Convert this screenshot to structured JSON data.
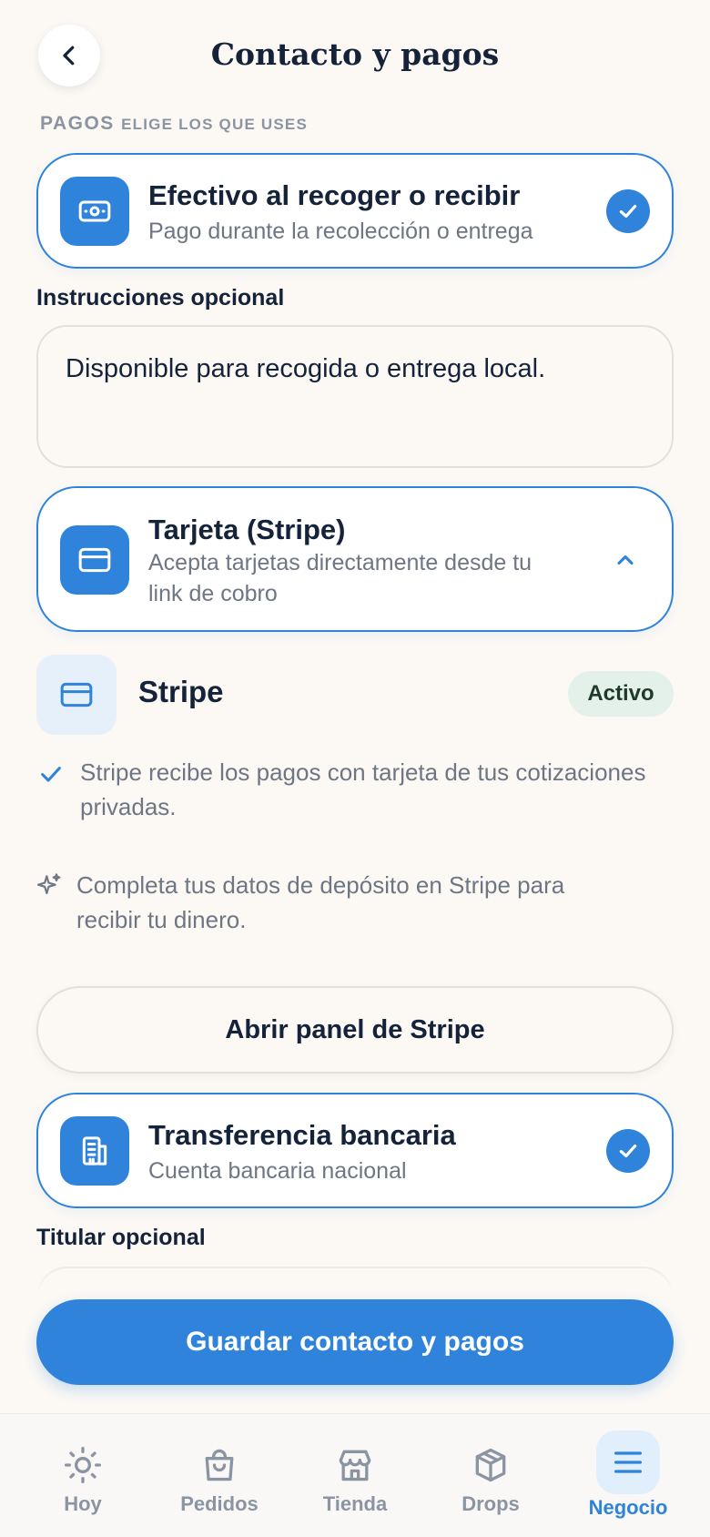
{
  "header": {
    "title": "Contacto y pagos"
  },
  "section": {
    "title": "PAGOS",
    "subtitle": "ELIGE LOS QUE USES"
  },
  "methods": {
    "cash": {
      "title": "Efectivo al recoger o recibir",
      "description": "Pago durante la recolección o entrega",
      "selected": true
    },
    "card": {
      "title": "Tarjeta (Stripe)",
      "description_line1": "Acepta tarjetas directamente desde tu",
      "description_line2": "link de cobro",
      "expanded": true
    },
    "bank": {
      "title": "Transferencia bancaria",
      "description": "Cuenta bancaria nacional",
      "selected": true
    }
  },
  "cash_instructions": {
    "label": "Instrucciones opcional",
    "value": "Disponible para recogida o entrega local."
  },
  "stripe": {
    "name": "Stripe",
    "status": "Activo",
    "note_check_line1": "Stripe recibe los pagos con tarjeta de tus cotizaciones",
    "note_check_line2": "privadas.",
    "note_hint_line1": "Completa tus datos de depósito en Stripe para",
    "note_hint_line2": "recibir tu dinero.",
    "open_button": "Abrir panel de Stripe"
  },
  "bank_holder": {
    "label": "Titular opcional"
  },
  "save_button": "Guardar contacto y pagos",
  "nav": {
    "items": [
      {
        "label": "Hoy",
        "icon": "sun-icon"
      },
      {
        "label": "Pedidos",
        "icon": "shopping-bag-icon"
      },
      {
        "label": "Tienda",
        "icon": "store-icon"
      },
      {
        "label": "Drops",
        "icon": "box-icon"
      },
      {
        "label": "Negocio",
        "icon": "menu-icon",
        "active": true
      }
    ]
  },
  "colors": {
    "accent": "#2f83db",
    "background": "#fcf9f5",
    "text": "#14223a",
    "muted": "#6e7684",
    "badge_bg": "#e4f1ea"
  }
}
